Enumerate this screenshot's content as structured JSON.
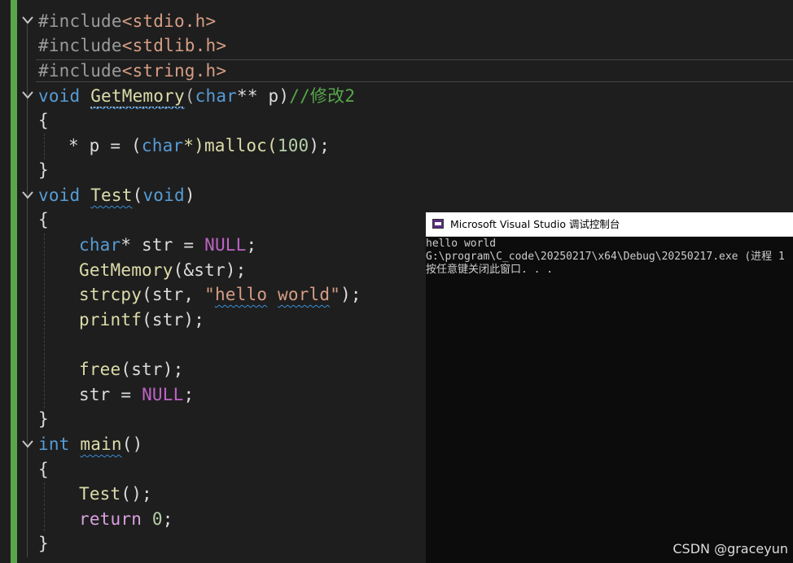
{
  "editor": {
    "lines": {
      "l1": {
        "a": "#include",
        "b": "<stdio.h>"
      },
      "l2": {
        "a": "#include",
        "b": "<stdlib.h>"
      },
      "l3": {
        "a": "#include",
        "b": "<string.h>"
      },
      "l4": {
        "kw": "void",
        "fn": "GetMemory",
        "p1": "(",
        "t": "char",
        "op": "** p)",
        "cm": "//修改2"
      },
      "l5": "{",
      "l6": {
        "a": "* p = (",
        "t": "char",
        "b": "*)malloc(",
        "n": "100",
        "c": ");"
      },
      "l7": "}",
      "l8": {
        "kw": "void",
        "fn": "Test",
        "p1": "(",
        "t": "void",
        "p2": ")"
      },
      "l9": "{",
      "l10": {
        "t": "char",
        "a": "* str = ",
        "m": "NULL",
        "b": ";"
      },
      "l11": {
        "fn": "GetMemory",
        "a": "(&str);"
      },
      "l12": {
        "fn": "strcpy",
        "a": "(str, ",
        "q1": "\"",
        "s1": "hello",
        "sp": " ",
        "s2": "world",
        "q2": "\"",
        "b": ");"
      },
      "l13": {
        "fn": "printf",
        "a": "(str);"
      },
      "l14": {
        "fn": "free",
        "a": "(str);"
      },
      "l15": {
        "a": "str = ",
        "m": "NULL",
        "b": ";"
      },
      "l16": "}",
      "l17": {
        "kw": "int",
        "fn": "main",
        "a": "()"
      },
      "l18": "{",
      "l19": {
        "fn": "Test",
        "a": "();"
      },
      "l20": {
        "ret": "return",
        "n": "0",
        "b": ";"
      },
      "l21": "}"
    }
  },
  "console": {
    "title": "Microsoft Visual Studio 调试控制台",
    "icon": "console-app-icon",
    "lines": [
      "hello world",
      "G:\\program\\C_code\\20250217\\x64\\Debug\\20250217.exe (进程 1",
      "按任意键关闭此窗口. . ."
    ]
  },
  "watermark": "CSDN @graceyun",
  "colors": {
    "background": "#1e1e1e",
    "keyword": "#569cd6",
    "function": "#dcdcaa",
    "string": "#d69d85",
    "comment": "#57a64a",
    "macro": "#bd63c5",
    "console_bg": "#0c0c0c"
  }
}
